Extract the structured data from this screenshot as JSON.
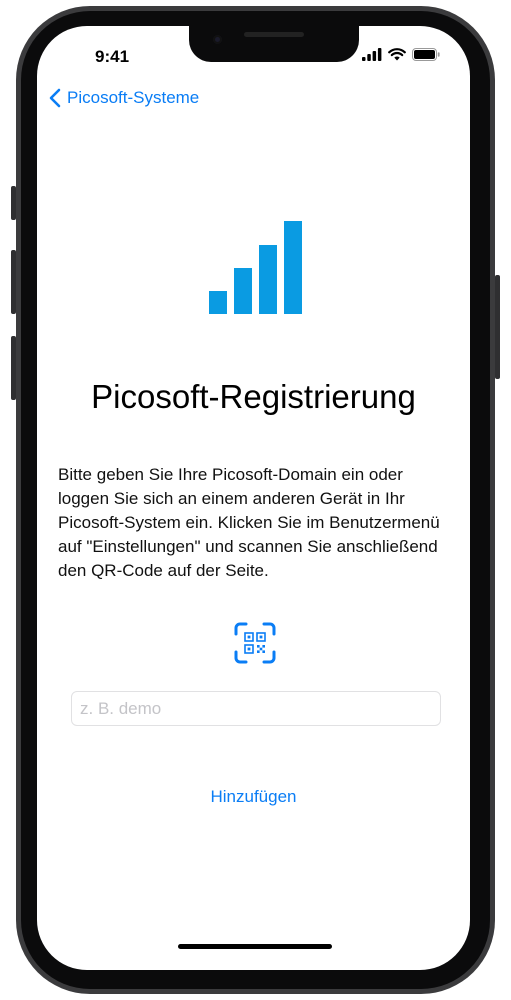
{
  "status_bar": {
    "time": "9:41"
  },
  "nav": {
    "back_label": "Picosoft-Systeme"
  },
  "page": {
    "title": "Picosoft-Registrierung",
    "description": "Bitte geben Sie Ihre Picosoft-Domain ein oder loggen Sie sich an einem anderen Gerät in Ihr Picosoft-System ein. Klicken Sie im Benutzermenü auf \"Einstellungen\" und scannen Sie anschließend den QR-Code auf der Seite."
  },
  "domain_input": {
    "value": "",
    "placeholder": "z. B. demo"
  },
  "add_button": {
    "label": "Hinzufügen"
  },
  "icons": {
    "back": "chevron-left-icon",
    "signal": "signal-bars-icon",
    "qr": "qr-code-scan-icon",
    "cellular": "cellular-signal-icon",
    "wifi": "wifi-icon",
    "battery": "battery-icon"
  },
  "colors": {
    "accent": "#0a7df5",
    "logo_bars": "#0a9be2"
  }
}
